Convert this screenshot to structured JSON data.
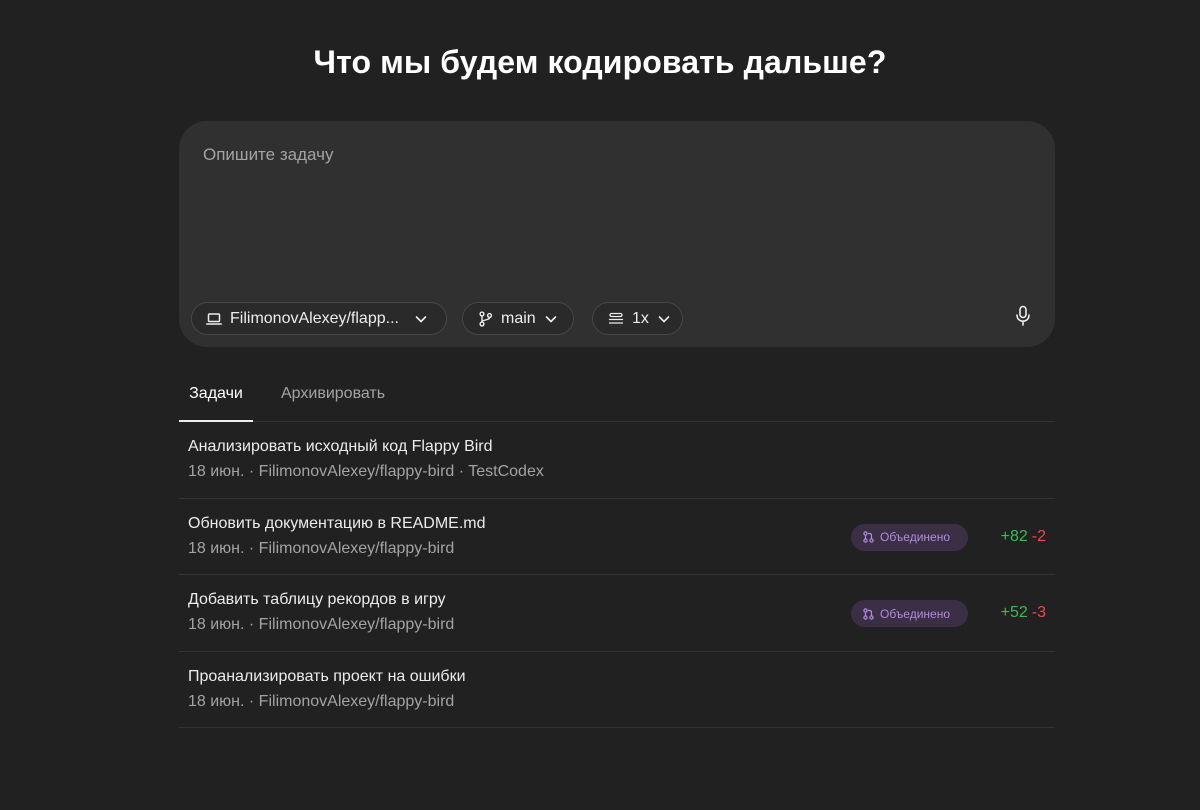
{
  "title": "Что мы будем кодировать дальше?",
  "composer": {
    "placeholder": "Опишите задачу",
    "repo": "FilimonovAlexey/flapp...",
    "branch": "main",
    "versions": "1x"
  },
  "tabs": [
    {
      "label": "Задачи",
      "active": true
    },
    {
      "label": "Архивировать",
      "active": false
    }
  ],
  "tasks": [
    {
      "title": "Анализировать исходный код Flappy Bird",
      "meta": "18 июн. · FilimonovAlexey/flappy-bird · TestCodex"
    },
    {
      "title": "Обновить документацию в README.md",
      "meta": "18 июн. · FilimonovAlexey/flappy-bird",
      "badge": "Объединено",
      "added": "+82",
      "removed": "-2"
    },
    {
      "title": "Добавить таблицу рекордов в игру",
      "meta": "18 июн. · FilimonovAlexey/flappy-bird",
      "badge": "Объединено",
      "added": "+52",
      "removed": "-3"
    },
    {
      "title": "Проанализировать проект на ошибки",
      "meta": "18 июн. · FilimonovAlexey/flappy-bird"
    }
  ],
  "colors": {
    "background": "#212121",
    "composer": "#303030",
    "badge_bg": "#3a2f45",
    "badge_text": "#b48be0",
    "added": "#3fb950",
    "removed": "#f04848"
  }
}
